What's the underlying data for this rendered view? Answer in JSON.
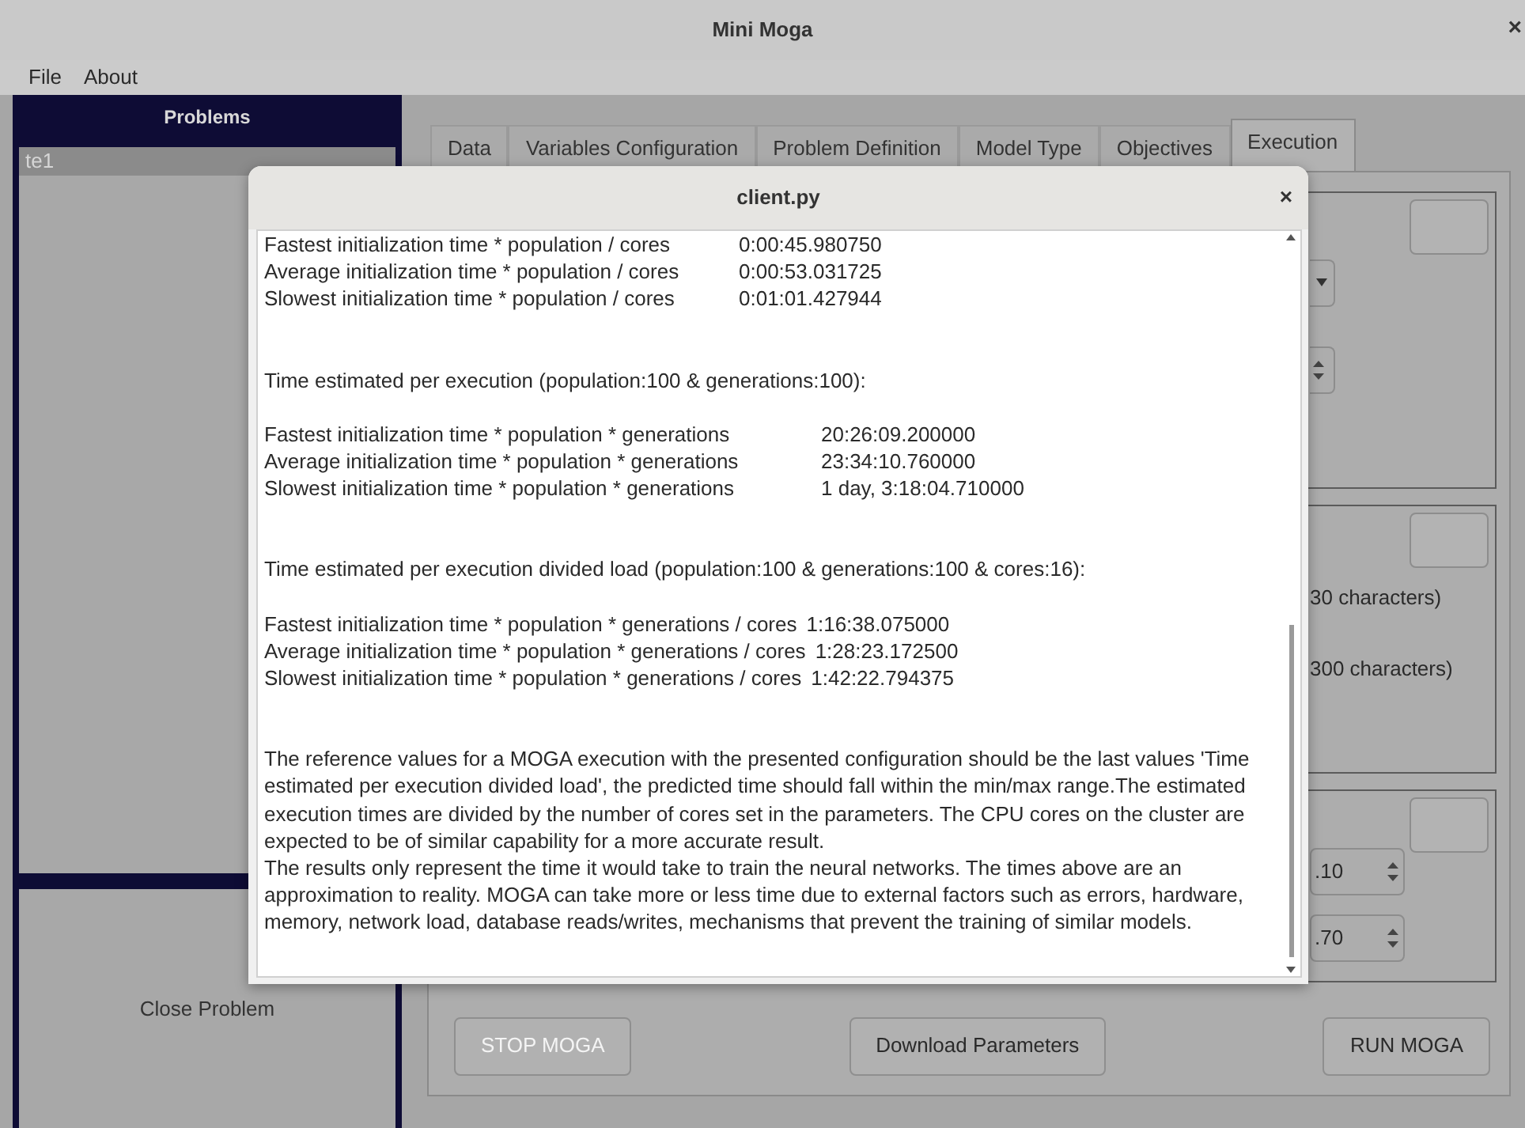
{
  "window": {
    "title": "Mini Moga",
    "close": "×"
  },
  "menu": [
    {
      "label": "File"
    },
    {
      "label": "About"
    }
  ],
  "sidebar": {
    "title": "Problems",
    "items": [
      {
        "label": "te1",
        "selected": true
      }
    ],
    "close_button": "Close Problem"
  },
  "tabs": [
    {
      "label": "Data",
      "selected": false
    },
    {
      "label": "Variables Configuration",
      "selected": false
    },
    {
      "label": "Problem Definition",
      "selected": false
    },
    {
      "label": "Model Type",
      "selected": false
    },
    {
      "label": "Objectives",
      "selected": false
    },
    {
      "label": "Execution",
      "selected": true
    }
  ],
  "execution": {
    "groups": [
      {
        "controls": [
          {
            "kind": "dropdown"
          },
          {
            "kind": "spinner"
          }
        ]
      },
      {
        "controls": [
          {
            "kind": "label",
            "text": "30 characters)"
          },
          {
            "kind": "label",
            "text": "300 characters)"
          }
        ]
      },
      {
        "controls": [
          {
            "kind": "spinner",
            "value": ".10"
          },
          {
            "kind": "spinner",
            "value": ".70"
          }
        ]
      }
    ],
    "buttons": [
      {
        "label": "STOP MOGA",
        "disabled": true
      },
      {
        "label": "Download Parameters",
        "disabled": false
      },
      {
        "label": "RUN MOGA",
        "disabled": false
      }
    ]
  },
  "dialog": {
    "title": "client.py",
    "close": "×",
    "sections": [
      {
        "kind": "table",
        "rows": [
          {
            "label": "Fastest initialization time * population / cores",
            "value": "0:00:45.980750"
          },
          {
            "label": "Average initialization time * population / cores",
            "value": "0:00:53.031725"
          },
          {
            "label": "Slowest initialization time * population / cores",
            "value": "0:01:01.427944"
          }
        ]
      },
      {
        "kind": "table",
        "heading": "Time estimated per execution (population:100 & generations:100):",
        "rows": [
          {
            "label": "Fastest initialization time * population * generations",
            "value": "20:26:09.200000"
          },
          {
            "label": "Average initialization time * population * generations",
            "value": "23:34:10.760000"
          },
          {
            "label": "Slowest initialization time * population * generations",
            "value": "1 day, 3:18:04.710000"
          }
        ]
      },
      {
        "kind": "inline",
        "heading": "Time estimated per execution divided load (population:100 & generations:100 & cores:16):",
        "rows": [
          {
            "label": "Fastest initialization time * population * generations / cores",
            "value": "1:16:38.075000"
          },
          {
            "label": "Average initialization time * population * generations / cores",
            "value": "1:28:23.172500"
          },
          {
            "label": "Slowest initialization time * population * generations / cores",
            "value": "1:42:22.794375"
          }
        ]
      }
    ],
    "notes": [
      "The reference values for a MOGA execution with the presented configuration should be the last values 'Time estimated per execution divided load', the predicted time should fall within the min/max range.The estimated execution times are divided by the number of cores set in the parameters. The CPU cores on the cluster are expected to be of similar capability for a more accurate result.",
      "The results only represent the time it would take to train the neural networks. The times above are an approximation to reality. MOGA can take more or less time due to external factors such as errors, hardware, memory, network load, database reads/writes, mechanisms that prevent the training of similar models."
    ]
  }
}
